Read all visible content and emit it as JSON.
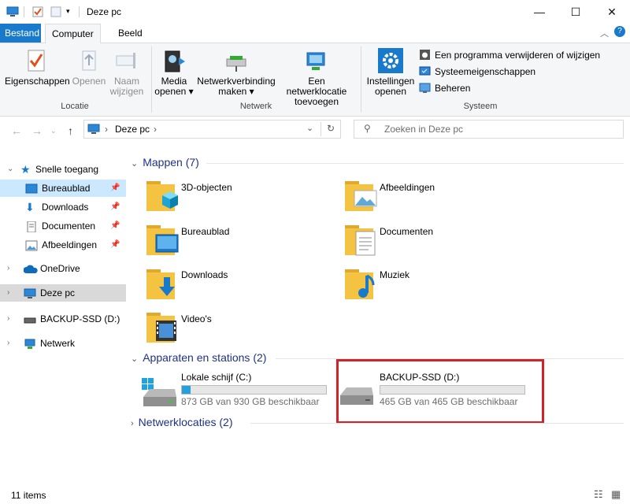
{
  "window": {
    "title": "Deze pc",
    "controls": {
      "minimize": "—",
      "maximize": "☐",
      "close": "✕"
    }
  },
  "ribbon_tabs": {
    "file": "Bestand",
    "computer": "Computer",
    "view": "Beeld"
  },
  "ribbon": {
    "location": {
      "properties": "Eigenschappen",
      "open": "Openen",
      "rename_line1": "Naam",
      "rename_line2": "wijzigen",
      "label": "Locatie"
    },
    "network": {
      "media_line1": "Media",
      "media_line2": "openen",
      "map_drive_line1": "Netwerkverbinding",
      "map_drive_line2": "maken",
      "add_location_line1": "Een netwerklocatie",
      "add_location_line2": "toevoegen",
      "label": "Netwerk"
    },
    "system": {
      "settings_line1": "Instellingen",
      "settings_line2": "openen",
      "uninstall": "Een programma verwijderen of wijzigen",
      "system_properties": "Systeemeigenschappen",
      "manage": "Beheren",
      "label": "Systeem"
    }
  },
  "address": {
    "path": "Deze pc",
    "search_placeholder": "Zoeken in Deze pc"
  },
  "nav": {
    "quick_access": "Snelle toegang",
    "desktop": "Bureaublad",
    "downloads": "Downloads",
    "documents": "Documenten",
    "pictures": "Afbeeldingen",
    "onedrive": "OneDrive",
    "this_pc": "Deze pc",
    "backup": "BACKUP-SSD (D:)",
    "network": "Netwerk"
  },
  "content": {
    "folders_header": "Mappen (7)",
    "folders": [
      "3D-objecten",
      "Afbeeldingen",
      "Bureaublad",
      "Documenten",
      "Downloads",
      "Muziek",
      "Video's"
    ],
    "devices_header": "Apparaten en stations (2)",
    "drives": [
      {
        "name": "Lokale schijf (C:)",
        "free": "873 GB van 930 GB beschikbaar",
        "used_fraction": 0.06
      },
      {
        "name": "BACKUP-SSD (D:)",
        "free": "465 GB van 465 GB beschikbaar",
        "used_fraction": 0.0
      }
    ],
    "network_header": "Netwerklocaties (2)"
  },
  "status": {
    "items": "11 items"
  },
  "colors": {
    "accent": "#1979ca",
    "highlight": "#d2232a",
    "drive_fill": "#26a0da",
    "folder": "#f5c342"
  }
}
